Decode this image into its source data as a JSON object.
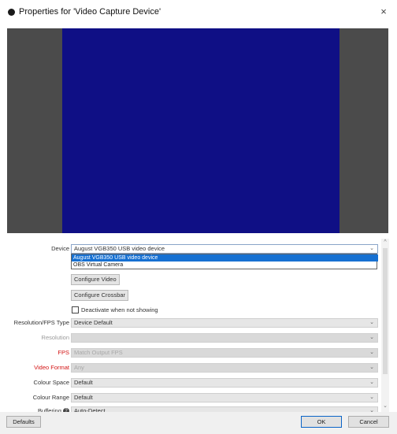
{
  "window": {
    "title": "Properties for 'Video Capture Device'",
    "close_glyph": "×"
  },
  "form": {
    "device": {
      "label": "Device",
      "value": "August VGB350 USB video device"
    },
    "device_options": [
      "August VGB350 USB video device",
      "OBS Virtual Camera"
    ],
    "configure_video_label": "Configure Video",
    "configure_crossbar_label": "Configure Crossbar",
    "deactivate_label": "Deactivate when not showing",
    "resolution_fps_type": {
      "label": "Resolution/FPS Type",
      "value": "Device Default"
    },
    "resolution": {
      "label": "Resolution",
      "value": ""
    },
    "fps": {
      "label": "FPS",
      "value": "Match Output FPS"
    },
    "video_format": {
      "label": "Video Format",
      "value": "Any"
    },
    "colour_space": {
      "label": "Colour Space",
      "value": "Default"
    },
    "colour_range": {
      "label": "Colour Range",
      "value": "Default"
    },
    "buffering": {
      "label": "Buffering",
      "value": "Auto-Detect"
    }
  },
  "buttons": {
    "defaults": "Defaults",
    "ok": "OK",
    "cancel": "Cancel"
  },
  "icons": {
    "app": "obs-logo-icon",
    "dropdown": "chevron-down-icon",
    "help": "question-icon"
  },
  "colors": {
    "preview_bg": "#4b4b4b",
    "preview_frame": "#0f0f85",
    "selection": "#1670d2",
    "warning_label": "#d31414"
  }
}
